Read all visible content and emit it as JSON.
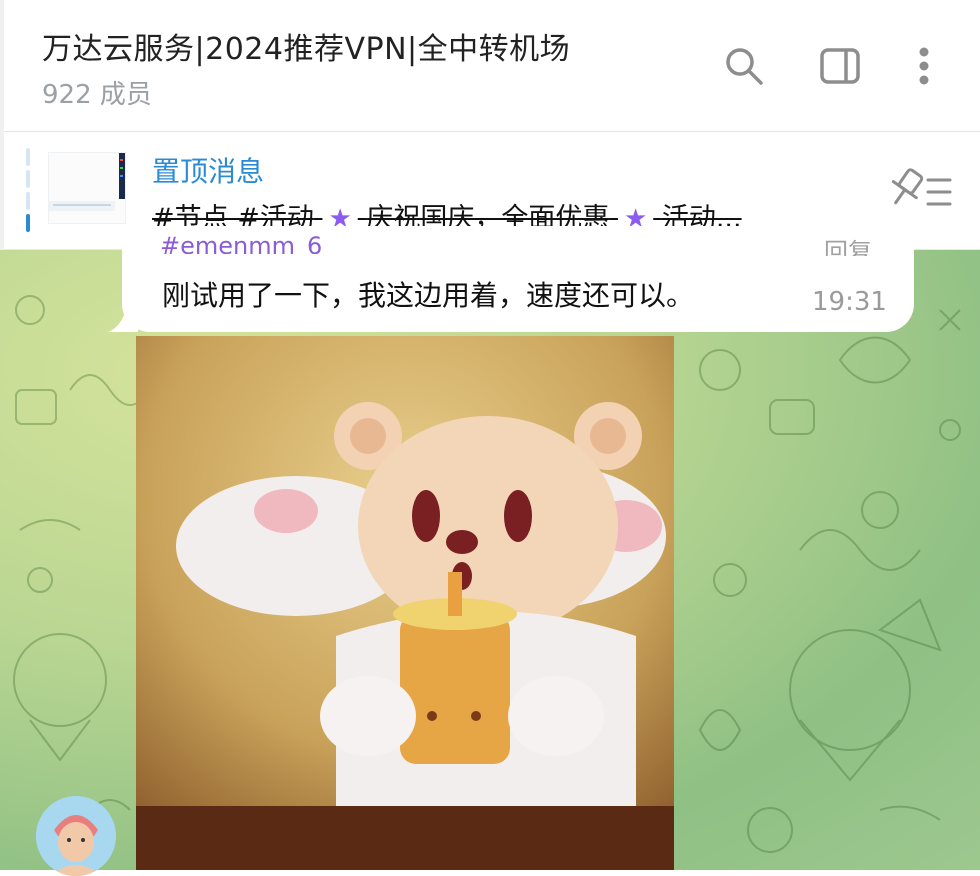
{
  "header": {
    "title": "万达云服务|2024推荐VPN|全中转机场",
    "member_count": "922 成员",
    "icons": [
      "search-icon",
      "sidebar-toggle-icon",
      "more-vertical-icon"
    ]
  },
  "pinned": {
    "label": "置顶消息",
    "text_part1": "#节点 #活动",
    "text_part2": "庆祝国庆，全面优惠",
    "text_part3": "活动...",
    "star1": "★",
    "star2": "★"
  },
  "message": {
    "sender_partial": "#emenmm_6",
    "reply_partial": "回复",
    "text": "刚试用了一下，我这边用着，速度还可以。",
    "time": "19:31"
  },
  "colors": {
    "accent": "#2a8bd4",
    "sender": "#8b5cd6",
    "chat_bg": "#a9cf8d"
  }
}
